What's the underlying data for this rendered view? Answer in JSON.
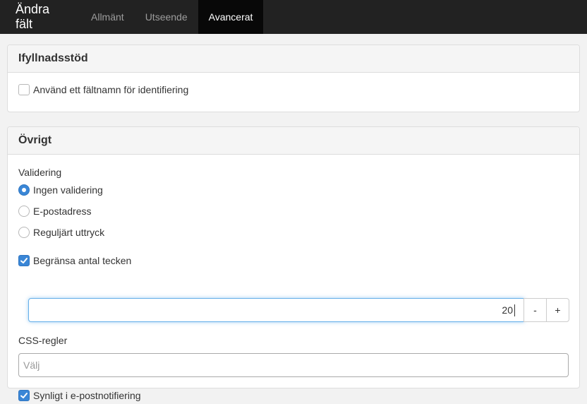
{
  "header": {
    "title": "Ändra fält",
    "tabs": [
      {
        "label": "Allmänt",
        "active": false
      },
      {
        "label": "Utseende",
        "active": false
      },
      {
        "label": "Avancerat",
        "active": true
      }
    ]
  },
  "autofill": {
    "heading": "Ifyllnadsstöd",
    "use_field_name": {
      "label": "Använd ett fältnamn för identifiering",
      "checked": false
    }
  },
  "other": {
    "heading": "Övrigt",
    "validation_label": "Validering",
    "validation_options": [
      {
        "label": "Ingen validering",
        "selected": true
      },
      {
        "label": "E-postadress",
        "selected": false
      },
      {
        "label": "Reguljärt uttryck",
        "selected": false
      }
    ],
    "limit_chars": {
      "label": "Begränsa antal tecken",
      "checked": true
    },
    "char_limit_value": "20",
    "decrement_label": "-",
    "increment_label": "+",
    "css_rules_label": "CSS-regler",
    "css_rules_placeholder": "Välj",
    "visible_in_email": {
      "label": "Synligt i e-postnotifiering",
      "checked": true
    }
  },
  "colors": {
    "topbar": "#222222",
    "active_tab": "#080808",
    "accent": "#3a86d6",
    "focus_border": "#66afe9"
  }
}
